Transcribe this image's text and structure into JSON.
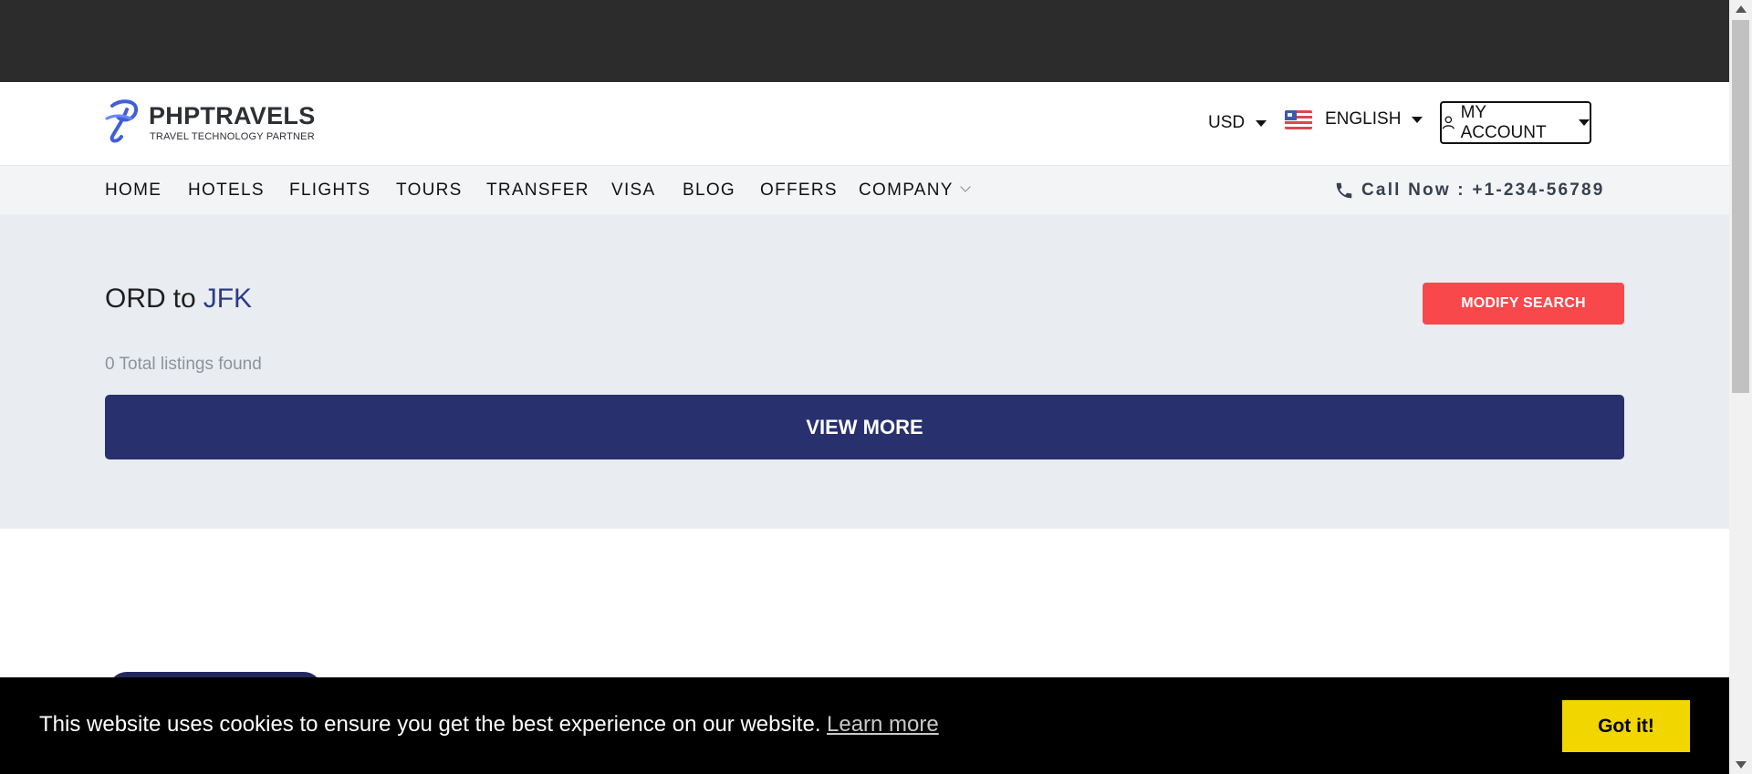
{
  "brand": {
    "name": "PHPTRAVELS",
    "tagline": "TRAVEL TECHNOLOGY PARTNER"
  },
  "header": {
    "currency": "USD",
    "language": "ENGLISH",
    "account": "MY ACCOUNT"
  },
  "nav": {
    "items": [
      "HOME",
      "HOTELS",
      "FLIGHTS",
      "TOURS",
      "TRANSFER",
      "VISA",
      "BLOG",
      "OFFERS",
      "COMPANY"
    ],
    "call": "Call Now : +1-234-56789"
  },
  "results": {
    "origin": "ORD",
    "connector": "to",
    "destination": "JFK",
    "count": "0 Total listings found",
    "modify_label": "MODIFY SEARCH",
    "view_more_label": "VIEW MORE"
  },
  "cookie": {
    "message": "This website uses cookies to ensure you get the best experience on our website.",
    "learn_more": "Learn more",
    "accept": "Got it!"
  },
  "colors": {
    "topbar": "#2c2c2c",
    "accent_red": "#f8484c",
    "primary_navy": "#28306e",
    "cookie_button": "#f1d600"
  }
}
